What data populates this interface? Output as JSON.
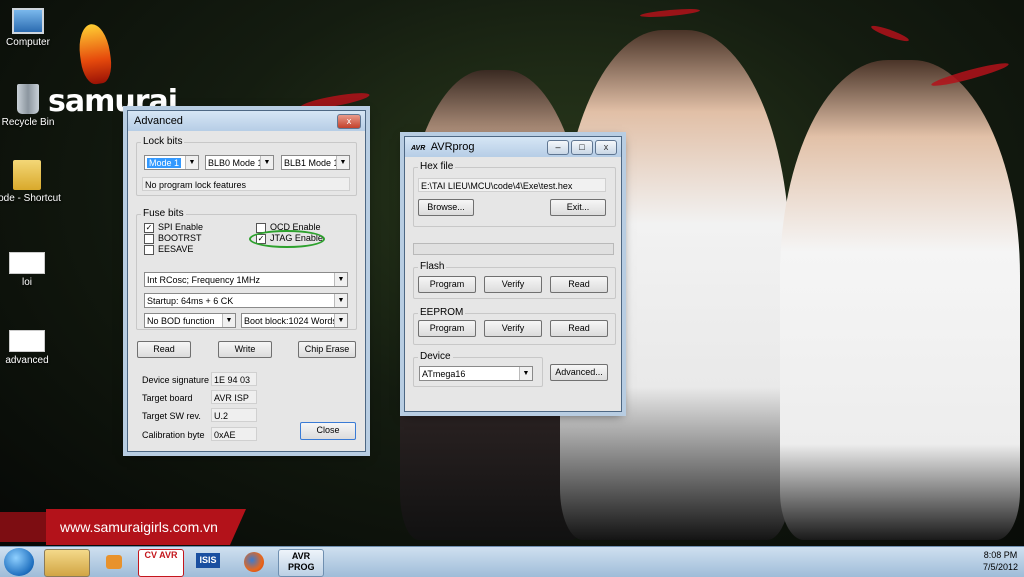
{
  "desktop": {
    "brand": "samurai",
    "url": "www.samuraigirls.com.vn",
    "icons": [
      {
        "label": "Computer",
        "icon": "computer-icon"
      },
      {
        "label": "Recycle Bin",
        "icon": "recycle-bin-icon"
      },
      {
        "label": "code - Shortcut",
        "icon": "folder-shortcut-icon"
      },
      {
        "label": "loi",
        "icon": "image-file-icon"
      },
      {
        "label": "advanced",
        "icon": "image-file-icon"
      }
    ]
  },
  "advanced": {
    "title": "Advanced",
    "lock_bits": {
      "label": "Lock bits",
      "mode": "Mode 1",
      "blb0": "BLB0 Mode 1",
      "blb1": "BLB1 Mode 1",
      "status": "No program lock features"
    },
    "fuse_bits": {
      "label": "Fuse bits",
      "spi": "SPI Enable",
      "ocd": "OCD Enable",
      "bootrst": "BOOTRST",
      "jtag": "JTAG Enable",
      "eesave": "EESAVE",
      "checked": "✓",
      "clock": "Int RCosc; Frequency 1MHz",
      "startup": "Startup: 64ms + 6 CK",
      "bod": "No BOD function",
      "bootblock": "Boot block:1024 Words"
    },
    "buttons": {
      "read": "Read",
      "write": "Write",
      "chip_erase": "Chip Erase",
      "close": "Close"
    },
    "info": {
      "device_signature_label": "Device signature",
      "device_signature": "1E 94 03",
      "target_board_label": "Target board",
      "target_board": "AVR ISP",
      "target_sw_label": "Target SW rev.",
      "target_sw": "U.2",
      "calibration_label": "Calibration byte",
      "calibration": "0xAE"
    },
    "close_glyph": "x"
  },
  "avrprog": {
    "title": "AVRprog",
    "logo": "AVR",
    "hex_file": {
      "label": "Hex file",
      "path": "E:\\TAI LIEU\\MCU\\code\\4\\Exe\\test.hex",
      "browse": "Browse...",
      "exit": "Exit..."
    },
    "flash": {
      "label": "Flash",
      "program": "Program",
      "verify": "Verify",
      "read": "Read"
    },
    "eeprom": {
      "label": "EEPROM",
      "program": "Program",
      "verify": "Verify",
      "read": "Read"
    },
    "device": {
      "label": "Device",
      "value": "ATmega16",
      "advanced": "Advanced..."
    },
    "controls": {
      "minimize": "–",
      "maximize": "□",
      "close": "x"
    }
  },
  "taskbar": {
    "apps": [
      {
        "label": "",
        "icon": "explorer-icon"
      },
      {
        "label": "",
        "icon": "media-player-icon"
      },
      {
        "label": "CV AVR",
        "icon": "cvavr-icon"
      },
      {
        "label": "ISIS",
        "icon": "isis-icon"
      },
      {
        "label": "",
        "icon": "firefox-icon"
      },
      {
        "label": "AVR PROG",
        "icon": "avrprog-icon"
      }
    ],
    "time": "8:08 PM",
    "date": "7/5/2012"
  },
  "colors": {
    "accent_red": "#b3121a",
    "highlight_green": "#2da12d",
    "selection_blue": "#3399ff"
  }
}
